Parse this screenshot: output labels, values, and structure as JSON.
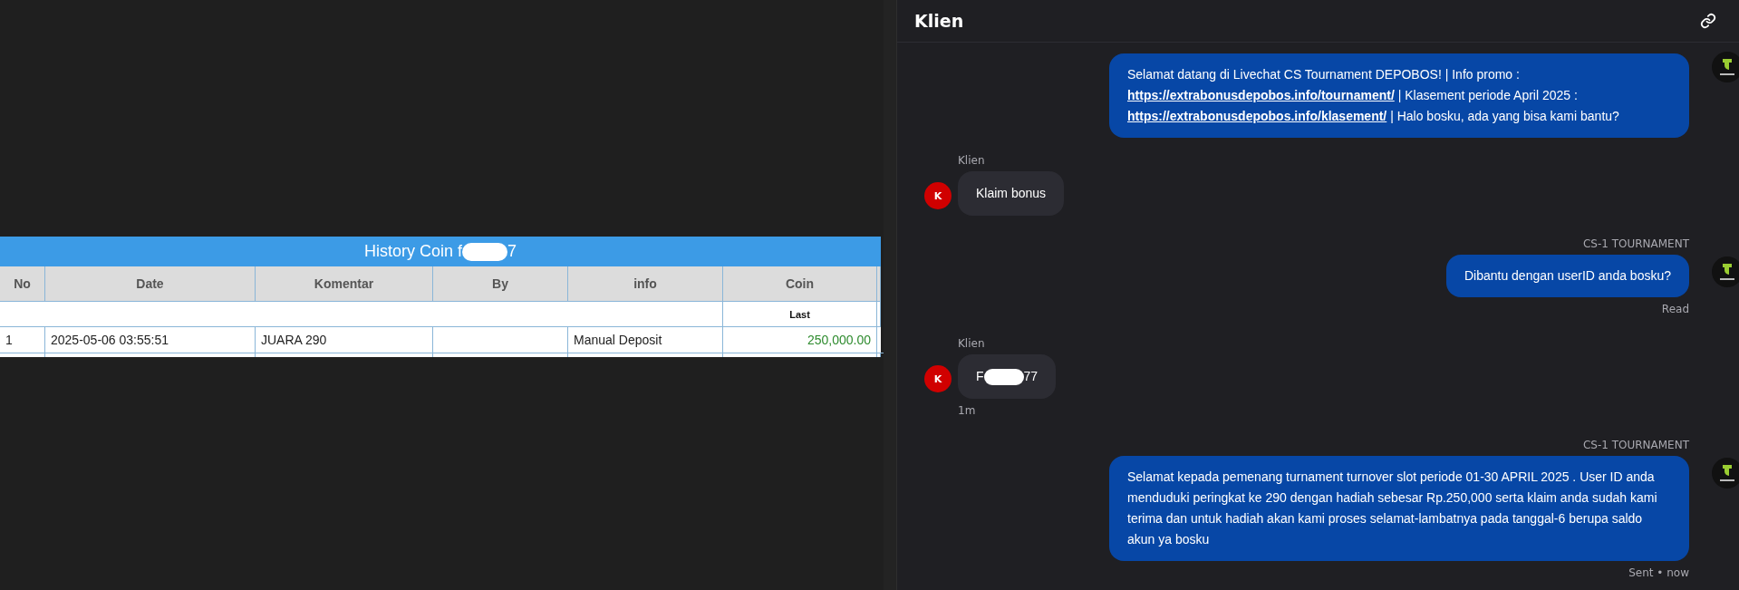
{
  "history_table": {
    "title_parts": [
      "History Coin f",
      "7"
    ],
    "columns": [
      "No",
      "Date",
      "Komentar",
      "By",
      "info",
      "Coin"
    ],
    "subheader": "Last",
    "rows": [
      {
        "cells": [
          "1",
          "2025-05-06 03:55:51",
          "JUARA 290",
          "",
          "Manual Deposit",
          "250,000.00"
        ]
      }
    ]
  },
  "chat": {
    "title": "Klien",
    "messages": [
      {
        "kind": "agent",
        "parts": [
          {
            "kind": "text",
            "text": "Selamat datang di Livechat CS Tournament DEPOBOS! | Info promo : "
          },
          {
            "kind": "link",
            "text": "https://extrabonusdepobos.info/tournament/"
          },
          {
            "kind": "text",
            "text": " | Klasement periode April 2025 : "
          },
          {
            "kind": "link",
            "text": "https://extrabonusdepobos.info/klasement/"
          },
          {
            "kind": "text",
            "text": " | Halo bosku, ada yang bisa kami bantu?"
          }
        ]
      },
      {
        "kind": "client",
        "sender": "Klien",
        "avatar": "K",
        "parts": [
          {
            "kind": "text",
            "text": "Klaim bonus"
          }
        ]
      },
      {
        "kind": "agent",
        "sender": "CS-1 TOURNAMENT",
        "parts": [
          {
            "kind": "text",
            "text": "Dibantu dengan userID anda bosku?"
          }
        ],
        "status": "Read"
      },
      {
        "kind": "client",
        "sender": "Klien",
        "avatar": "K",
        "parts": [
          {
            "kind": "text",
            "text": "F"
          },
          {
            "kind": "redacted"
          },
          {
            "kind": "text",
            "text": "77"
          }
        ],
        "status": "1m"
      },
      {
        "kind": "agent",
        "sender": "CS-1 TOURNAMENT",
        "parts": [
          {
            "kind": "text",
            "text": "Selamat kepada pemenang turnament turnover slot periode 01-30 APRIL 2025 . User ID anda menduduki peringkat ke 290 dengan hadiah sebesar Rp.250,000 serta klaim anda sudah kami terima dan untuk hadiah akan kami proses selamat-lambatnya pada tanggal-6 berupa saldo akun ya bosku"
          }
        ],
        "status": "Sent • now"
      }
    ]
  }
}
